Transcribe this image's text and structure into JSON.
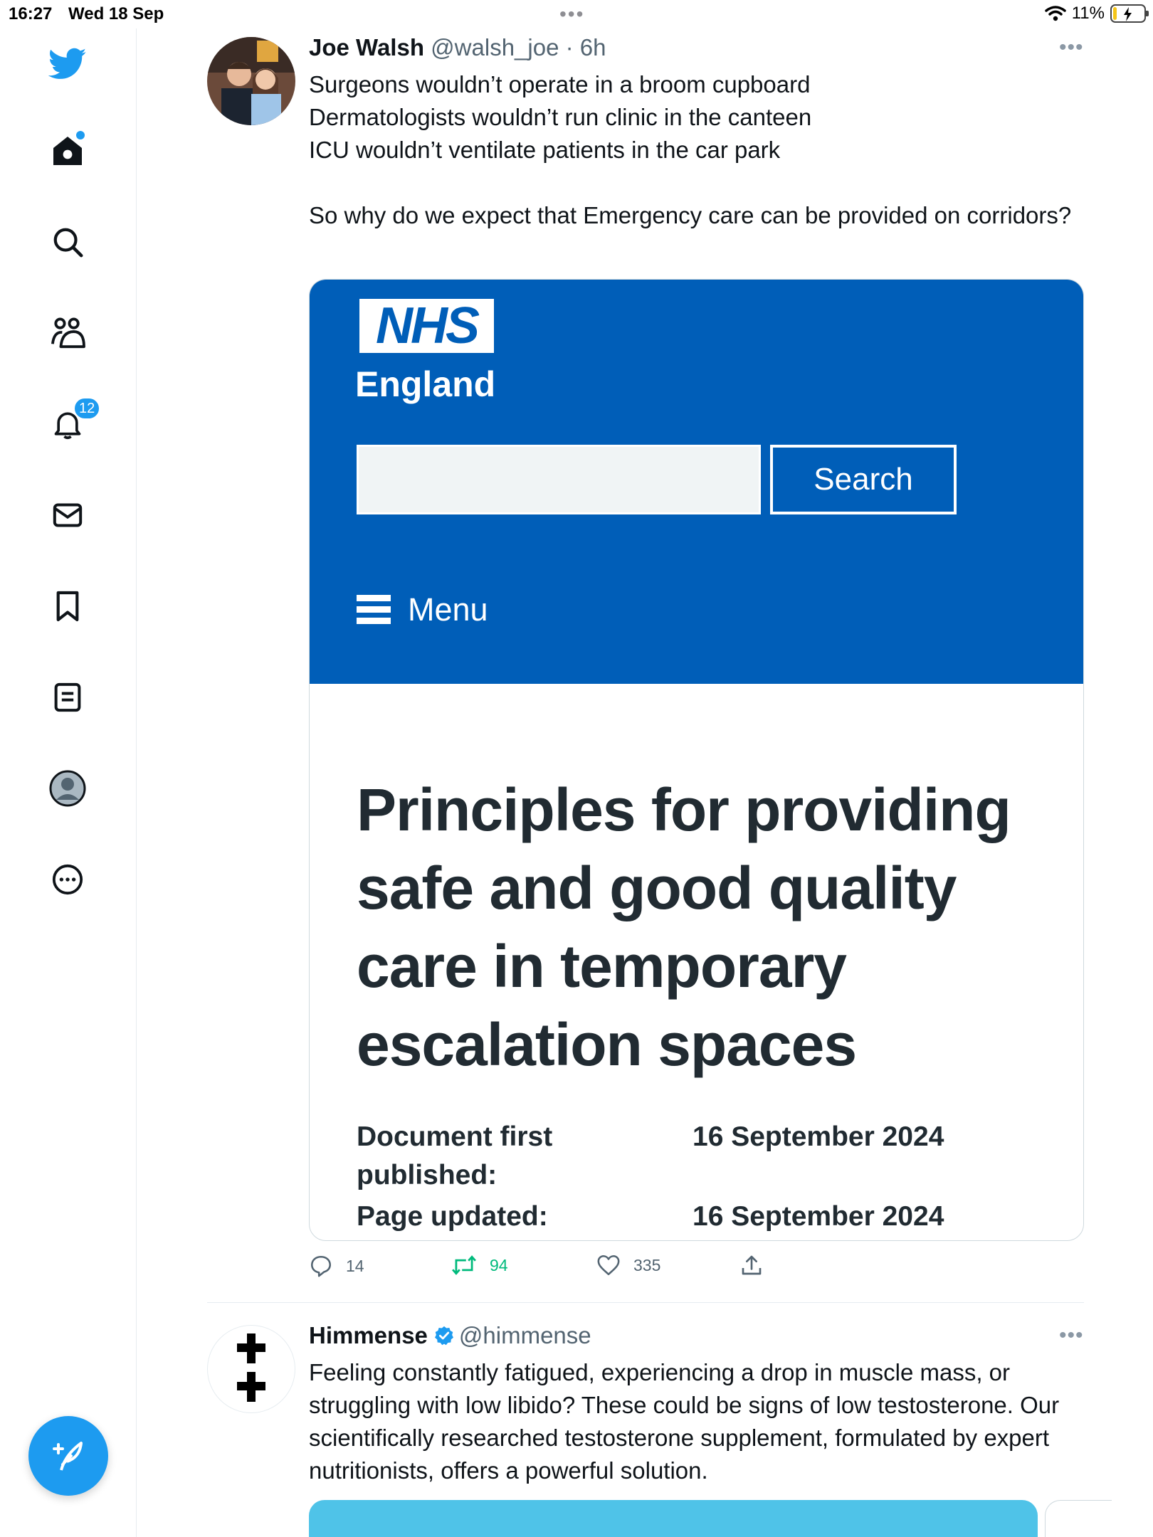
{
  "status_bar": {
    "time": "16:27",
    "date": "Wed 18 Sep",
    "battery_text": "11%",
    "battery_level": 0.11
  },
  "sidebar": {
    "items": [
      {
        "name": "home",
        "icon": "home-icon",
        "has_dot": true
      },
      {
        "name": "explore",
        "icon": "search-icon"
      },
      {
        "name": "communities",
        "icon": "people-icon"
      },
      {
        "name": "notifications",
        "icon": "bell-icon",
        "badge": "12"
      },
      {
        "name": "messages",
        "icon": "mail-icon"
      },
      {
        "name": "bookmarks",
        "icon": "bookmark-icon"
      },
      {
        "name": "lists",
        "icon": "list-icon"
      },
      {
        "name": "profile",
        "icon": "profile-icon"
      },
      {
        "name": "more",
        "icon": "more-circle-icon"
      }
    ],
    "compose_icon": "compose-feather-icon",
    "brand_color": "#1d9bf0"
  },
  "tweet1": {
    "name": "Joe Walsh",
    "handle": "@walsh_joe",
    "time": " · 6h",
    "text": "Surgeons wouldn’t operate in a broom cupboard\nDermatologists wouldn’t run clinic in the canteen\nICU wouldn’t ventilate patients in the car park\n\nSo why do we expect that Emergency care can be provided on corridors?",
    "card": {
      "logo": "NHS",
      "org": "England",
      "search_button": "Search",
      "menu_label": "Menu",
      "title": "Principles for providing safe and good quality care in temporary escalation spaces",
      "meta": [
        {
          "label": "Document first published:",
          "value": "16 September 2024"
        },
        {
          "label": "Page updated:",
          "value": "16 September 2024"
        }
      ],
      "brand_color": "#005eb8"
    },
    "actions": {
      "replies": "14",
      "retweets": "94",
      "likes": "335"
    }
  },
  "tweet2": {
    "name": "Himmense",
    "handle": "@himmense",
    "text": "Feeling constantly fatigued, experiencing a drop in muscle mass, or struggling with low libido? These could be signs of low testosterone. Our scientifically researched testosterone supplement, formulated by expert nutritionists, offers a powerful solution."
  }
}
